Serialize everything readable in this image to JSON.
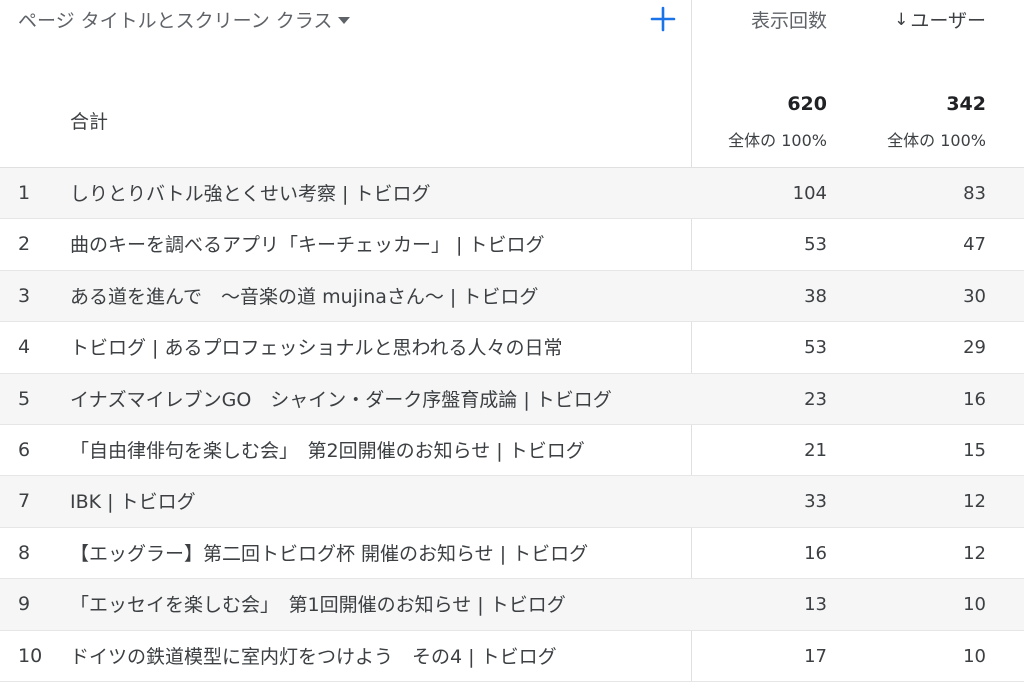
{
  "header": {
    "dimension_label": "ページ タイトルとスクリーン クラス",
    "col_views": "表示回数",
    "col_users": "ユーザー",
    "sort_arrow": "↓"
  },
  "totals": {
    "label": "合計",
    "views": "620",
    "views_pct": "全体の 100%",
    "users": "342",
    "users_pct": "全体の 100%"
  },
  "rows": [
    {
      "idx": "1",
      "title": "しりとりバトル強とくせい考察 | トビログ",
      "views": "104",
      "users": "83"
    },
    {
      "idx": "2",
      "title": "曲のキーを調べるアプリ「キーチェッカー」 | トビログ",
      "views": "53",
      "users": "47"
    },
    {
      "idx": "3",
      "title": "ある道を進んで　～音楽の道 mujinaさん～ | トビログ",
      "views": "38",
      "users": "30"
    },
    {
      "idx": "4",
      "title": "トビログ | あるプロフェッショナルと思われる人々の日常",
      "views": "53",
      "users": "29"
    },
    {
      "idx": "5",
      "title": "イナズマイレブンGO　シャイン・ダーク序盤育成論 | トビログ",
      "views": "23",
      "users": "16"
    },
    {
      "idx": "6",
      "title": "「自由律俳句を楽しむ会」　第2回開催のお知らせ | トビログ",
      "views": "21",
      "users": "15"
    },
    {
      "idx": "7",
      "title": "IBK | トビログ",
      "views": "33",
      "users": "12"
    },
    {
      "idx": "8",
      "title": "【エッグラー】第二回トビログ杯 開催のお知らせ | トビログ",
      "views": "16",
      "users": "12"
    },
    {
      "idx": "9",
      "title": "「エッセイを楽しむ会」　第1回開催のお知らせ | トビログ",
      "views": "13",
      "users": "10"
    },
    {
      "idx": "10",
      "title": "ドイツの鉄道模型に室内灯をつけよう　その4 | トビログ",
      "views": "17",
      "users": "10"
    }
  ],
  "colors": {
    "accent": "#1a73e8",
    "alt_row": "#f6f6f6",
    "divider": "#e0e0e0"
  }
}
